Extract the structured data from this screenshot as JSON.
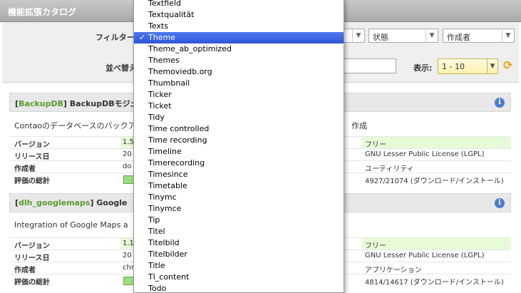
{
  "title": "機能拡張カタログ",
  "filters": {
    "label": "フィルター",
    "status": "状態",
    "author": "作成者"
  },
  "sort": {
    "label": "並べ替え"
  },
  "display": {
    "label": "表示:",
    "value": "1 - 10"
  },
  "extensions": [
    {
      "code": "BackupDB",
      "name": "BackupDBモジュ",
      "desc": "Contaoのデータベースのバックア",
      "desc2": "作成",
      "version_label": "バージョン",
      "version": "1.5",
      "release_label": "リリース日",
      "release": "20",
      "author_label": "作成者",
      "author": "do",
      "rating_label": "評価の総計",
      "license_price": "フリー",
      "license": "GNU Lesser Public License (LGPL)",
      "category": "ユーティリティ",
      "downloads": "4927/21074 (ダウンロード/インストール)"
    },
    {
      "code": "dlh_googlemaps",
      "name": "Google",
      "desc": "Integration of Google Maps a",
      "desc2": "",
      "version_label": "バージョン",
      "version": "1.1",
      "release_label": "リリース日",
      "release": "20",
      "author_label": "作成者",
      "author": "chr",
      "rating_label": "評価の総計",
      "license_price": "フリー",
      "license": "GNU Lesser Public License (LGPL)",
      "category": "アプリケーション",
      "downloads": "4814/14617 (ダウンロード/インストール)"
    }
  ],
  "dropdown": {
    "selected": "Theme",
    "items": [
      "Textfield",
      "Textqualität",
      "Texts",
      "Theme",
      "Theme_ab_optimized",
      "Themes",
      "Themoviedb.org",
      "Thumbnail",
      "Ticker",
      "Ticket",
      "Tidy",
      "Time controlled",
      "Time recording",
      "Timeline",
      "Timerecording",
      "Timesince",
      "Timetable",
      "Tinymc",
      "Tinymce",
      "Tip",
      "Titel",
      "Titelbild",
      "Titelbilder",
      "Title",
      "Tl_content",
      "Todo"
    ]
  }
}
